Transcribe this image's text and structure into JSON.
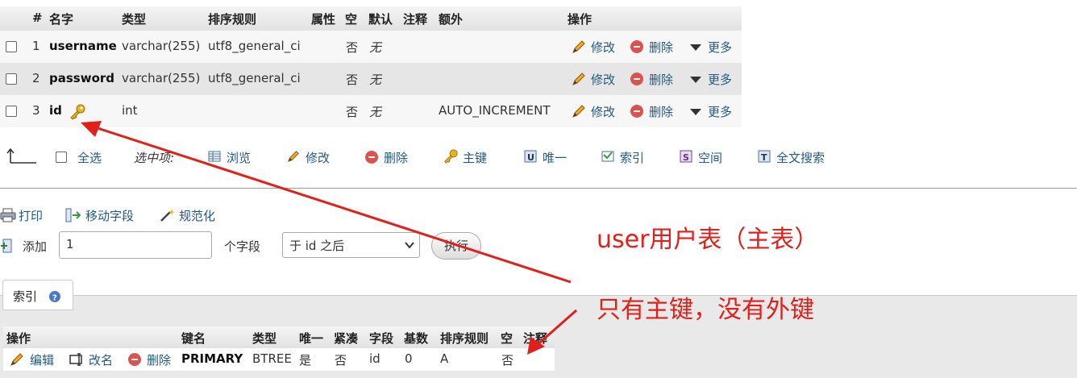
{
  "structure": {
    "headers": [
      "#",
      "名字",
      "类型",
      "排序规则",
      "属性",
      "空",
      "默认",
      "注释",
      "额外",
      "操作"
    ],
    "rows": [
      {
        "num": "1",
        "name": "username",
        "type": "varchar(255)",
        "collation": "utf8_general_ci",
        "null": "否",
        "default": "无",
        "extra": ""
      },
      {
        "num": "2",
        "name": "password",
        "type": "varchar(255)",
        "collation": "utf8_general_ci",
        "null": "否",
        "default": "无",
        "extra": ""
      },
      {
        "num": "3",
        "name": "id",
        "type": "int",
        "collation": "",
        "null": "否",
        "default": "无",
        "extra": "AUTO_INCREMENT"
      }
    ],
    "row_actions": {
      "edit": "修改",
      "drop": "删除",
      "more": "更多"
    }
  },
  "toolbar": {
    "check_all": "全选",
    "with_selected": "选中项:",
    "browse": "浏览",
    "change": "修改",
    "drop": "删除",
    "primary": "主键",
    "unique": "唯一",
    "index": "索引",
    "spatial": "空间",
    "fulltext": "全文搜索"
  },
  "actions": {
    "print": "打印",
    "move_columns": "移动字段",
    "normalize": "规范化",
    "add": "添加",
    "add_count": "1",
    "fields_label": "个字段",
    "position": "于 id 之后",
    "go": "执行"
  },
  "indexes": {
    "tab_label": "索引",
    "headers": [
      "操作",
      "键名",
      "类型",
      "唯一",
      "紧凑",
      "字段",
      "基数",
      "排序规则",
      "空",
      "注释"
    ],
    "row": {
      "edit": "编辑",
      "rename": "改名",
      "drop": "删除",
      "keyname": "PRIMARY",
      "type": "BTREE",
      "unique": "是",
      "packed": "否",
      "column": "id",
      "cardinality": "0",
      "collation": "A",
      "null": "否",
      "comment": ""
    }
  },
  "annotations": {
    "line1": "user用户表（主表）",
    "line2": "只有主键，没有外键"
  },
  "colors": {
    "link": "#235a81",
    "annotation": "#e0201a",
    "drop_icon": "#d9534f",
    "key_icon": "#e6b422"
  }
}
